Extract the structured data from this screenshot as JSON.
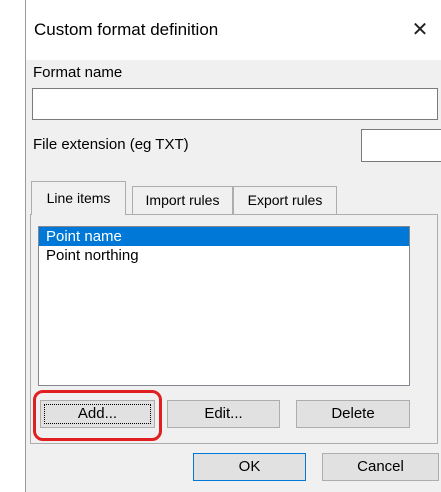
{
  "window": {
    "title": "Custom format definition",
    "close_glyph": "✕"
  },
  "fields": {
    "format_name_label": "Format name",
    "format_name_value": "",
    "file_extension_label": "File extension (eg TXT)",
    "file_extension_value": ""
  },
  "tabs": [
    {
      "label": "Line items",
      "active": true
    },
    {
      "label": "Import rules",
      "active": false
    },
    {
      "label": "Export rules",
      "active": false
    }
  ],
  "list_items": [
    {
      "label": "Point name",
      "selected": true
    },
    {
      "label": "Point northing",
      "selected": false
    }
  ],
  "buttons": {
    "add": "Add...",
    "edit": "Edit...",
    "delete": "Delete",
    "ok": "OK",
    "cancel": "Cancel"
  },
  "colors": {
    "selection": "#0078d7",
    "highlight": "#e02020"
  }
}
